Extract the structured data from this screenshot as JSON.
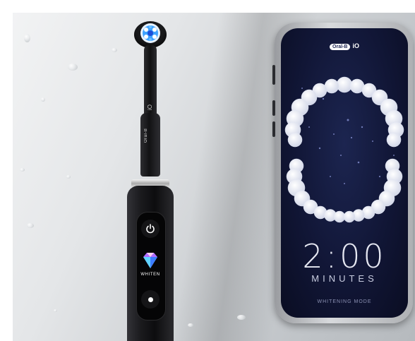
{
  "toothbrush": {
    "neck_logo": "Oral-B",
    "neck_series": "iO",
    "mode_label": "WHITEN",
    "icons": [
      "power-icon",
      "diamond-icon",
      "mode-dot-icon"
    ]
  },
  "phone_app": {
    "brand_pill": "Oral-B",
    "brand_suffix": "iO",
    "timer": "2:00",
    "timer_unit": "MINUTES",
    "mode": "WHITENING MODE"
  },
  "colors": {
    "screen_bg": "#111636",
    "brush_body": "#121214",
    "accent_blue": "#3fa3ff",
    "tooth_white": "#ffffff"
  }
}
